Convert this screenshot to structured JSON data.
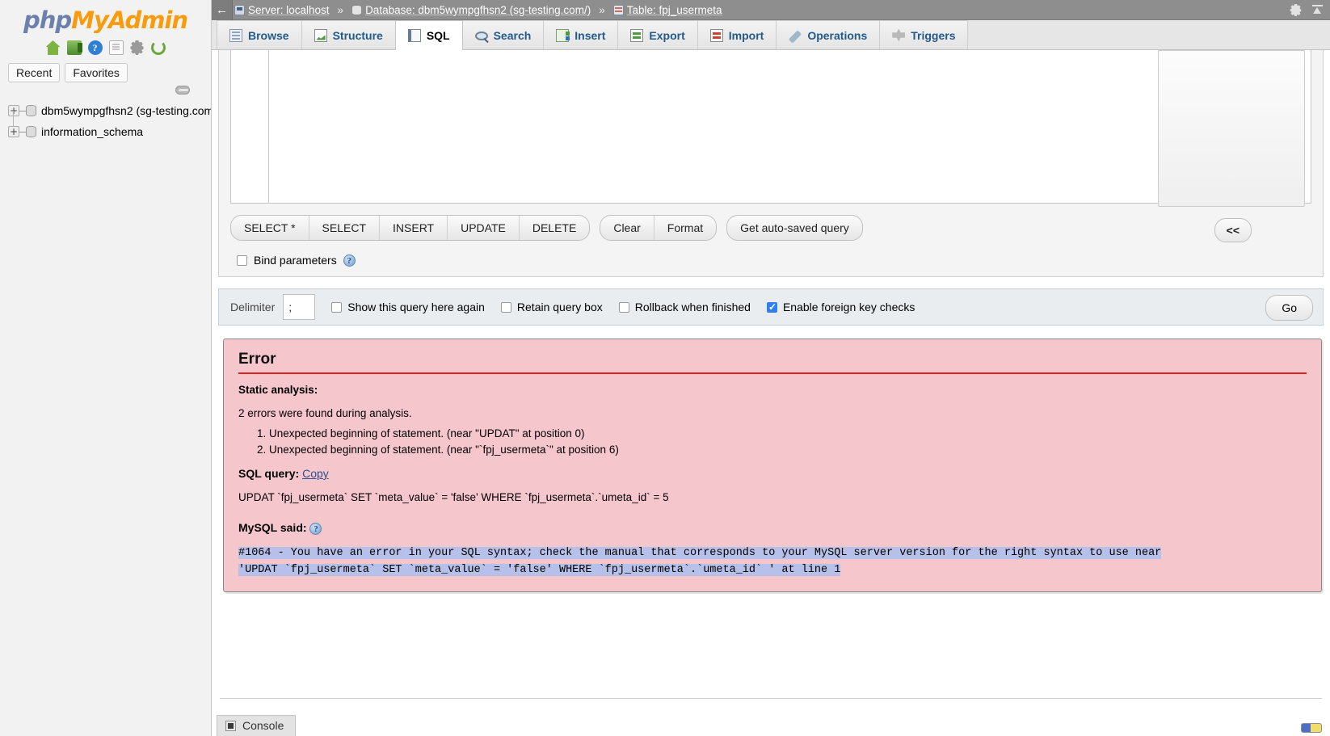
{
  "app": {
    "logo_php": "php",
    "logo_my": "My",
    "logo_admin": "Admin"
  },
  "sidebar": {
    "icons": [
      {
        "name": "home-icon",
        "label": "Home"
      },
      {
        "name": "logout-icon",
        "label": "Log out"
      },
      {
        "name": "help-docs-icon",
        "label": "phpMyAdmin documentation",
        "glyph": "?"
      },
      {
        "name": "documentation-icon",
        "label": "Documentation"
      },
      {
        "name": "settings-icon",
        "label": "Settings"
      },
      {
        "name": "reload-icon",
        "label": "Reload navigation"
      }
    ],
    "tabs": [
      {
        "label": "Recent"
      },
      {
        "label": "Favorites"
      }
    ],
    "databases": [
      {
        "label": "dbm5wympgfhsn2 (sg-testing.com",
        "expander": "+"
      },
      {
        "label": "information_schema",
        "expander": "+"
      }
    ]
  },
  "topbar": {
    "back_glyph": "←",
    "crumbs": [
      {
        "icon": "server-icon",
        "label": "Server: localhost"
      },
      {
        "icon": "database-icon",
        "label": "Database: dbm5wympgfhsn2 (sg-testing.com/)"
      },
      {
        "icon": "table-icon",
        "label": "Table: fpj_usermeta"
      }
    ],
    "separator": "»",
    "gear_label": "Settings",
    "collapse_label": "Collapse"
  },
  "tabs": [
    {
      "label": "Browse",
      "icon": "browse-icon",
      "active": false
    },
    {
      "label": "Structure",
      "icon": "structure-icon",
      "active": false
    },
    {
      "label": "SQL",
      "icon": "sql-icon",
      "active": true
    },
    {
      "label": "Search",
      "icon": "search-icon",
      "active": false
    },
    {
      "label": "Insert",
      "icon": "insert-icon",
      "active": false
    },
    {
      "label": "Export",
      "icon": "export-icon",
      "active": false
    },
    {
      "label": "Import",
      "icon": "import-icon",
      "active": false
    },
    {
      "label": "Operations",
      "icon": "operations-icon",
      "active": false
    },
    {
      "label": "Triggers",
      "icon": "triggers-icon",
      "active": false
    }
  ],
  "query_editor": {
    "value": "",
    "column_selector_value": "",
    "collapse_button_label": "<<"
  },
  "query_buttons": {
    "group1": [
      {
        "label": "SELECT *"
      },
      {
        "label": "SELECT"
      },
      {
        "label": "INSERT"
      },
      {
        "label": "UPDATE"
      },
      {
        "label": "DELETE"
      }
    ],
    "group2": [
      {
        "label": "Clear"
      },
      {
        "label": "Format"
      }
    ],
    "group3": [
      {
        "label": "Get auto-saved query"
      }
    ]
  },
  "bind_parameters": {
    "label": "Bind parameters",
    "checked": false,
    "help_glyph": "?"
  },
  "delimiter_bar": {
    "label": "Delimiter",
    "value": ";",
    "options": [
      {
        "label": "Show this query here again",
        "checked": false
      },
      {
        "label": "Retain query box",
        "checked": false
      },
      {
        "label": "Rollback when finished",
        "checked": false
      },
      {
        "label": "Enable foreign key checks",
        "checked": true
      }
    ],
    "go_label": "Go"
  },
  "error": {
    "title": "Error",
    "static_analysis_heading": "Static analysis:",
    "summary": "2 errors were found during analysis.",
    "items": [
      "Unexpected beginning of statement. (near \"UPDAT\" at position 0)",
      "Unexpected beginning of statement. (near \"`fpj_usermeta`\" at position 6)"
    ],
    "sql_query_label": "SQL query:",
    "copy_link": "Copy",
    "sql_text": "UPDAT `fpj_usermeta` SET `meta_value` = 'false' WHERE `fpj_usermeta`.`umeta_id` = 5",
    "mysql_said_label": "MySQL said:",
    "mysql_help_glyph": "?",
    "mysql_message_line1": "#1064 - You have an error in your SQL syntax; check the manual that corresponds to your MySQL server version for the right syntax to use near",
    "mysql_message_line2": "'UPDAT `fpj_usermeta` SET `meta_value` = 'false' WHERE `fpj_usermeta`.`umeta_id` ' at line 1"
  },
  "console": {
    "label": "Console"
  },
  "colors": {
    "error_bg": "#f6c6cd",
    "error_rule": "#e02020",
    "accent_blue": "#2f7ef5",
    "tab_link": "#235a8a",
    "logo_blue": "#6c80ae",
    "logo_orange": "#f89c0e",
    "topbar_bg": "#8e8e8e",
    "mono_highlight": "#b7c0e8"
  }
}
